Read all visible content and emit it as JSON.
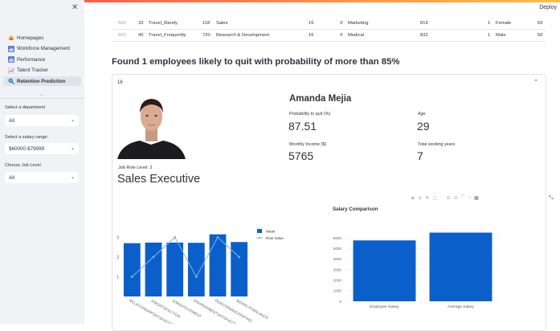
{
  "header": {
    "deploy_label": "Deploy"
  },
  "sidebar": {
    "nav": [
      {
        "label": "Homepages",
        "icon": "house-icon"
      },
      {
        "label": "Workforce Management",
        "icon": "bar-chart-icon"
      },
      {
        "label": "Performance",
        "icon": "bar-chart-icon"
      },
      {
        "label": "Talent Tracker",
        "icon": "chart-icon"
      },
      {
        "label": "Retention Prediction",
        "icon": "magnifier-icon"
      }
    ],
    "department": {
      "label": "Select a department",
      "value": "All"
    },
    "salary": {
      "label": "Select a salary range:",
      "value": "$60000-$79999"
    },
    "job_level": {
      "label": "Choose Job Level",
      "value": "All"
    }
  },
  "table": {
    "rows": [
      [
        "591",
        "33",
        "Travel_Rarely",
        "118",
        "Sales",
        "16",
        "3",
        "Marketing",
        "819",
        "1",
        "Female",
        "69"
      ],
      [
        "601",
        "40",
        "Travel_Frequently",
        "720",
        "Research & Development",
        "16",
        "4",
        "Medical",
        "832",
        "1",
        "Male",
        "56"
      ]
    ]
  },
  "main": {
    "heading": "Found 1 employees likely to quit with probability of more than 85%",
    "expander_label": "16",
    "employee": {
      "name": "Amanda Mejia",
      "prob_label": "Probability to quit (%)",
      "prob_value": "87.51",
      "age_label": "Age",
      "age_value": "29",
      "income_label": "Monthly Income ($)",
      "income_value": "5765",
      "years_label": "Total working years",
      "years_value": "7",
      "job_level_text": "Job Role Level: 2",
      "job_title": "Sales Executive"
    }
  },
  "colors": {
    "bar": "#0b5fcb",
    "line": "#7fb3e8"
  },
  "chart_data": [
    {
      "type": "bar",
      "categories": [
        "RELATIONSHIPSATISFACTION",
        "JOBSATISFACTION",
        "JOBINVOLVEMENT",
        "ENVIRONMENTSATISFACTION",
        "PERFORMANCERATING",
        "WORKLIFEBALANCE"
      ],
      "series": [
        {
          "name": "Mean",
          "kind": "bar",
          "values": [
            2.7,
            2.73,
            2.73,
            2.72,
            3.15,
            2.76
          ]
        },
        {
          "name": "Row Value",
          "kind": "line",
          "values": [
            1,
            2,
            3,
            1,
            3,
            2
          ]
        }
      ],
      "yticks": [
        "1",
        "2",
        "3"
      ],
      "ylim": [
        0,
        3.3
      ]
    },
    {
      "type": "bar",
      "title": "Salary Comparison",
      "categories": [
        "Employee Salary",
        "Average Salary"
      ],
      "values": [
        5765,
        6503
      ],
      "yticks": [
        "0",
        "1000",
        "2000",
        "3000",
        "4000",
        "5000",
        "6000"
      ],
      "ylim": [
        0,
        7000
      ]
    }
  ]
}
